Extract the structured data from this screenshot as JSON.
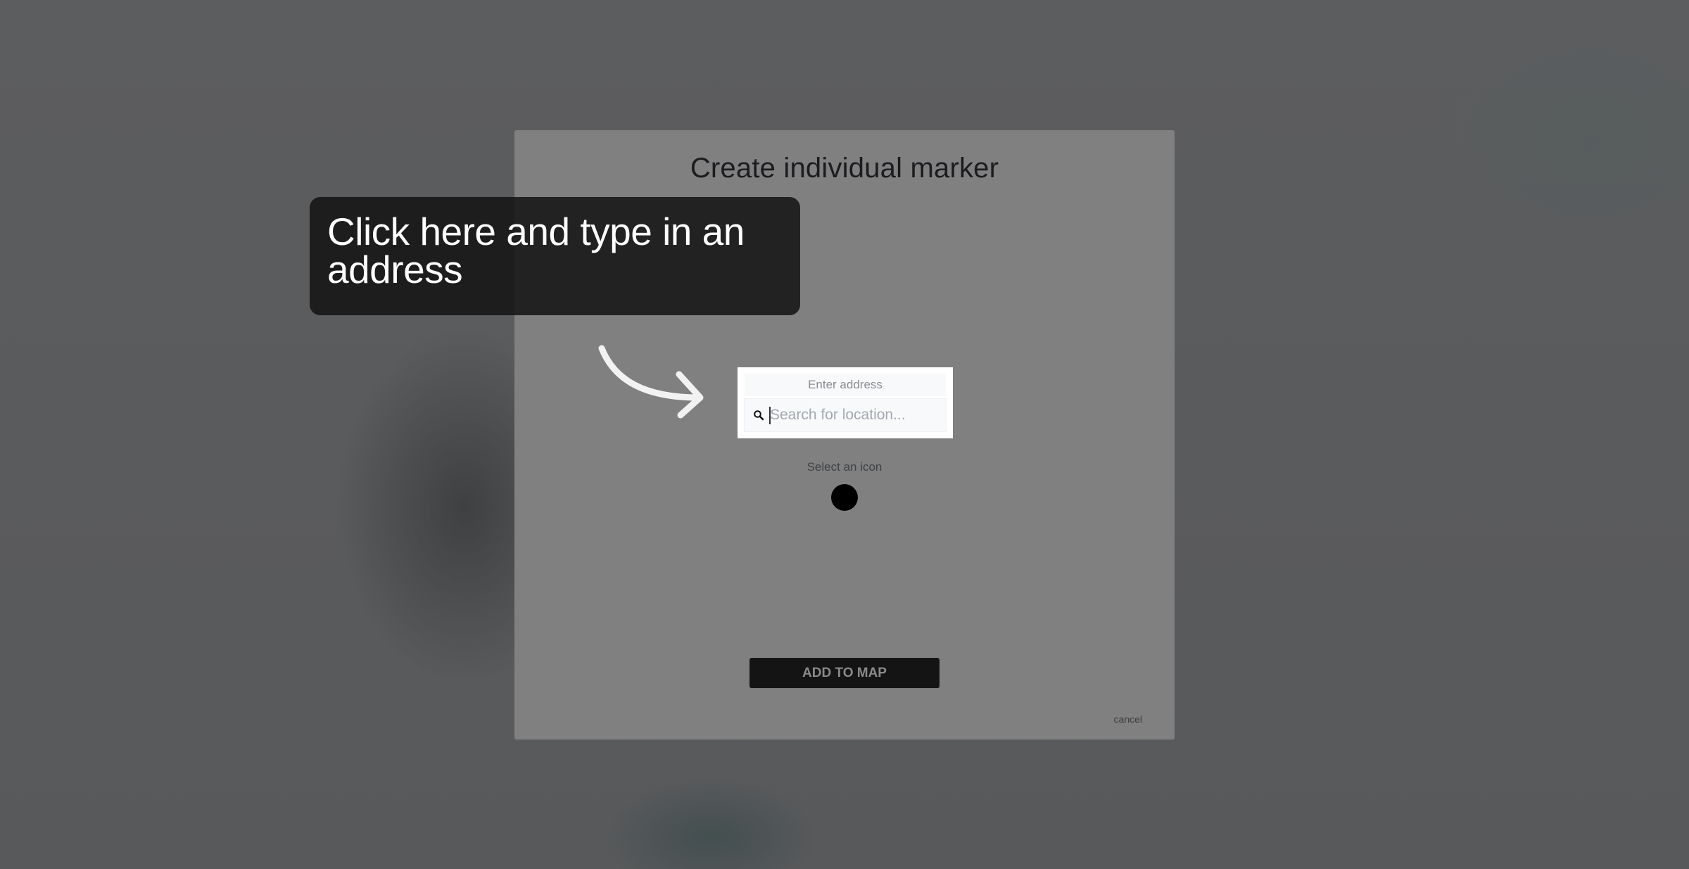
{
  "modal": {
    "title": "Create individual marker",
    "address_label": "Enter address",
    "search": {
      "value": "",
      "placeholder": "Search for location..."
    },
    "select_icon_label": "Select an icon",
    "add_button_label": "ADD TO MAP",
    "cancel_label": "cancel"
  },
  "tooltip": {
    "text": "Click here and type in an address"
  },
  "icons": {
    "search": "search-icon",
    "marker_option": "circle-marker-icon",
    "pointer": "curved-arrow-icon"
  },
  "colors": {
    "overlay": "#595a5c",
    "modal_background": "#808080",
    "tooltip_background": "#141414",
    "button_background": "#141414",
    "marker_icon": "#000000"
  }
}
